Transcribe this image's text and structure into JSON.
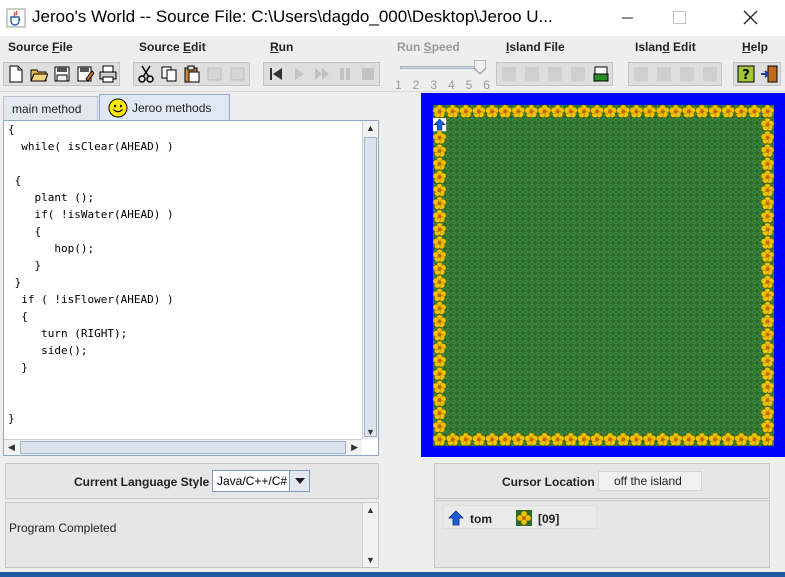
{
  "window": {
    "title": "Jeroo's World -- Source File: C:\\Users\\dagdo_000\\Desktop\\Jeroo U..."
  },
  "menu": [
    {
      "label": "Source File",
      "mnemonic": "F"
    },
    {
      "label": "Source Edit",
      "mnemonic": "E"
    },
    {
      "label": "Run",
      "mnemonic": "R"
    },
    {
      "label": "Run Speed",
      "mnemonic": "S",
      "disabled": true
    },
    {
      "label": "Island File",
      "mnemonic": "I"
    },
    {
      "label": "Island Edit",
      "mnemonic": "d"
    },
    {
      "label": "Help",
      "mnemonic": "H"
    }
  ],
  "run_speed": {
    "ticks": [
      "1",
      "2",
      "3",
      "4",
      "5",
      "6"
    ],
    "value": 6
  },
  "tabs": {
    "main": "main method",
    "jeroo": "Jeroo methods",
    "active": "jeroo"
  },
  "editor": {
    "lines": [
      "{",
      "  while( isClear(AHEAD) )",
      "",
      " {",
      "    plant ();",
      "    if( !isWater(AHEAD) )",
      "    {",
      "       hop();",
      "    }",
      " }",
      "  if ( !isFlower(AHEAD) )",
      "  {",
      "     turn (RIGHT);",
      "     side();",
      "  }",
      "",
      "",
      "}"
    ]
  },
  "language": {
    "label": "Current Language Style",
    "value": "Java/C++/C#"
  },
  "status": {
    "message": "Program Completed"
  },
  "cursor": {
    "label": "Cursor Location",
    "value": "off the island"
  },
  "jeroos": [
    {
      "name": "tom",
      "flowers": "[09]",
      "direction": "north"
    }
  ],
  "colors": {
    "water": "#0000ff",
    "grass": "#2d6b2d",
    "flower": "#f2c300",
    "jeroo_arrow": "#1d5fd6"
  }
}
